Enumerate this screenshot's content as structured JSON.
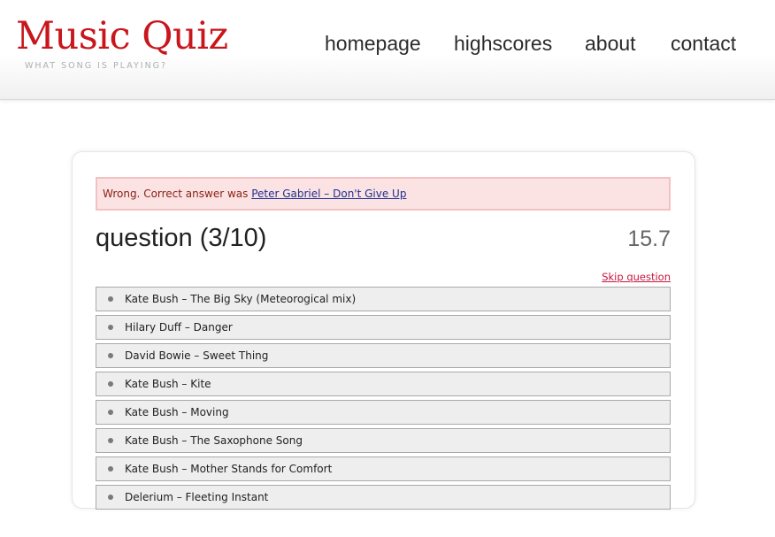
{
  "header": {
    "logo": "Music Quiz",
    "tagline": "WHAT SONG IS PLAYING?",
    "nav": [
      {
        "label": "homepage"
      },
      {
        "label": "highscores"
      },
      {
        "label": "about"
      },
      {
        "label": "contact"
      }
    ]
  },
  "feedback": {
    "prefix": "Wrong. Correct answer was ",
    "correct_answer": "Peter Gabriel – Don't Give Up"
  },
  "question": {
    "title": "question (3/10)",
    "timer": "15.7",
    "skip_label": "Skip question"
  },
  "answers": [
    {
      "label": "Kate Bush – The Big Sky (Meteorogical mix)"
    },
    {
      "label": "Hilary Duff – Danger"
    },
    {
      "label": "David Bowie – Sweet Thing"
    },
    {
      "label": "Kate Bush – Kite"
    },
    {
      "label": "Kate Bush – Moving"
    },
    {
      "label": "Kate Bush – The Saxophone Song"
    },
    {
      "label": "Kate Bush – Mother Stands for Comfort"
    },
    {
      "label": "Delerium – Fleeting Instant"
    }
  ],
  "colors": {
    "logo": "#c9161c",
    "alert_background": "#fbe3e4",
    "alert_border": "#f4c0c2",
    "alert_text": "#8a1f11",
    "link": "#1f2f8f",
    "skip_link": "#c5163c",
    "answer_background": "#eeeeee"
  }
}
